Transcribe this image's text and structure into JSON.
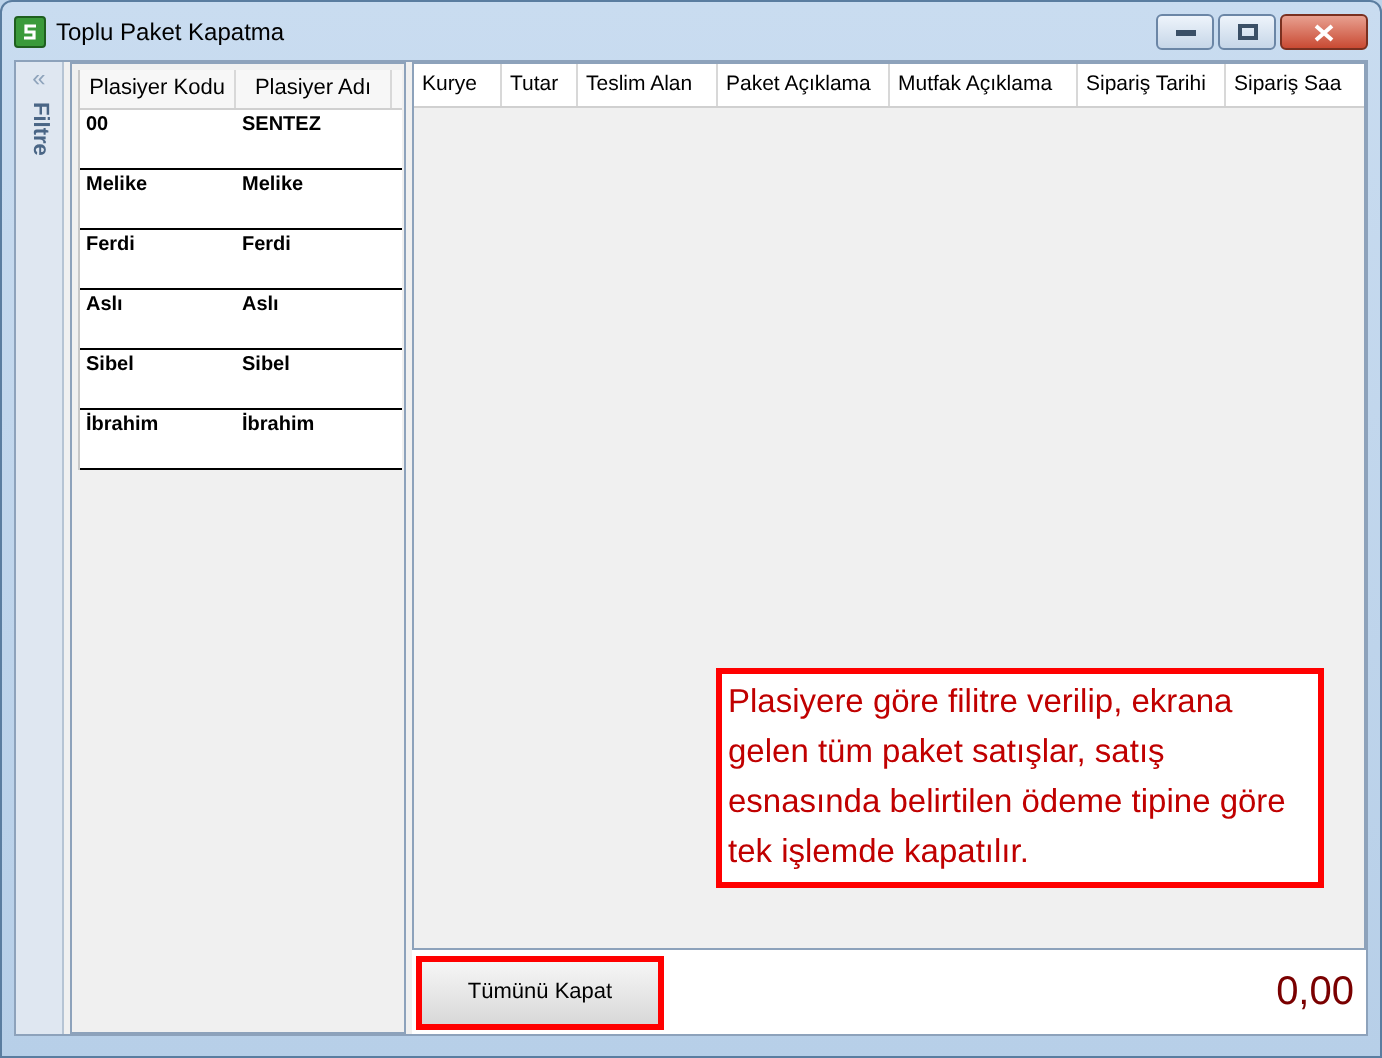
{
  "window": {
    "title": "Toplu Paket Kapatma"
  },
  "filter_panel": {
    "label": "Filtre",
    "collapse": "«"
  },
  "salesperson_table": {
    "columns": [
      "Plasiyer Kodu",
      "Plasiyer Adı"
    ],
    "rows": [
      [
        "00",
        "SENTEZ"
      ],
      [
        "Melike",
        "Melike"
      ],
      [
        "Ferdi",
        "Ferdi"
      ],
      [
        "Aslı",
        "Aslı"
      ],
      [
        "Sibel",
        "Sibel"
      ],
      [
        "İbrahim",
        "İbrahim"
      ]
    ]
  },
  "orders_table": {
    "columns": [
      "Kurye",
      "Tutar",
      "Teslim Alan",
      "Paket Açıklama",
      "Mutfak Açıklama",
      "Sipariş Tarihi",
      "Sipariş Saa"
    ]
  },
  "annotation": "Plasiyere göre filitre verilip, ekrana gelen tüm paket satışlar, satış esnasında belirtilen ödeme  tipine göre tek işlemde kapatılır.",
  "footer": {
    "button": "Tümünü Kapat",
    "total": "0,00"
  }
}
